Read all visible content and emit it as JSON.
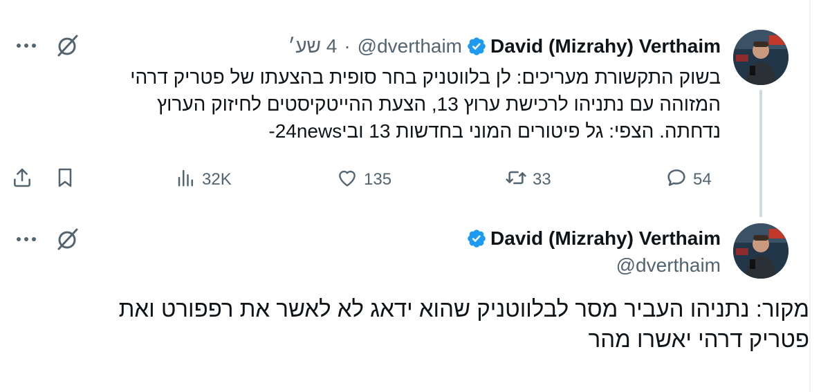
{
  "colors": {
    "text_primary": "#0f1419",
    "text_secondary": "#536471",
    "verified_blue": "#1d9bf0",
    "thread_line": "#cfd9de"
  },
  "quoted_tweet": {
    "author_name": "David (Mizrahy) Verthaim",
    "handle": "@dverthaim",
    "separator": "·",
    "time": "4 שע׳",
    "text_lines": [
      "בשוק התקשורת מעריכים: לן בלווטניק בחר סופית בהצעתו של פטריק דרהי",
      "המזוהה עם נתניהו לרכישת ערוץ 13, הצעת ההייטקיסטים לחיזוק הערוץ",
      "נדחתה. הצפי: גל פיטורים המוני בחדשות 13 ובי24news-"
    ],
    "actions": {
      "reply_count": "54",
      "retweet_count": "33",
      "like_count": "135",
      "views_count": "32K"
    },
    "icons": {
      "more": "more-icon",
      "grok": "grok-icon",
      "verified": "verified-badge-icon",
      "reply": "reply-icon",
      "retweet": "retweet-icon",
      "like": "heart-icon",
      "views": "views-icon",
      "bookmark": "bookmark-icon",
      "share": "share-icon"
    }
  },
  "main_tweet": {
    "author_name": "David (Mizrahy) Verthaim",
    "handle": "@dverthaim",
    "text_lines": [
      "מקור: נתניהו העביר מסר לבלווטניק שהוא ידאג לא לאשר את רפפורט ואת",
      "פטריק דרהי יאשרו מהר"
    ]
  }
}
